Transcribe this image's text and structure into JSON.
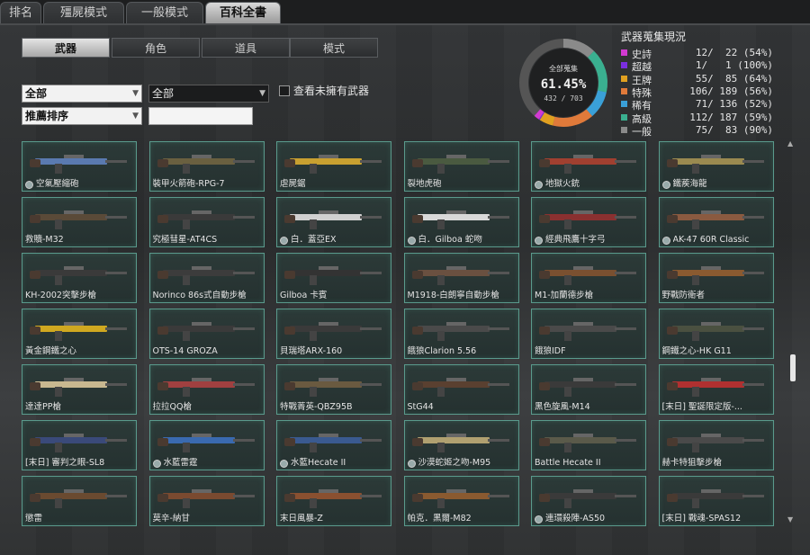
{
  "top_tabs": [
    {
      "label": "排名",
      "active": false
    },
    {
      "label": "殭屍模式",
      "active": false
    },
    {
      "label": "一般模式",
      "active": false
    },
    {
      "label": "百科全書",
      "active": true
    }
  ],
  "sub_tabs": [
    {
      "label": "武器",
      "active": true
    },
    {
      "label": "角色",
      "active": false
    },
    {
      "label": "道具",
      "active": false
    },
    {
      "label": "模式",
      "active": false
    }
  ],
  "filters": {
    "category_1": "全部",
    "category_2": "全部",
    "sort": "推薦排序",
    "search_value": "",
    "unowned_label": "查看未擁有武器",
    "unowned_checked": false
  },
  "collection": {
    "title": "武器蒐集現況",
    "donut_label": "全部蒐集",
    "donut_percent": "61.45%",
    "donut_count": "432 / 703",
    "percent_value": 61.45,
    "rarities": [
      {
        "name": "史詩",
        "value": "12/  22 (54%)",
        "color": "#d23ad2"
      },
      {
        "name": "超越",
        "value": " 1/   1 (100%)",
        "color": "#7a2ee0"
      },
      {
        "name": "王牌",
        "value": "55/  85 (64%)",
        "color": "#e0a020"
      },
      {
        "name": "特殊",
        "value": "106/ 189 (56%)",
        "color": "#e07a3a"
      },
      {
        "name": "稀有",
        "value": " 71/ 136 (52%)",
        "color": "#3aa0d8"
      },
      {
        "name": "高級",
        "value": "112/ 187 (59%)",
        "color": "#3ab090"
      },
      {
        "name": "一般",
        "value": " 75/  83 (90%)",
        "color": "#8a8a8a"
      }
    ]
  },
  "weapons": [
    {
      "label": "空氣壓縮砲",
      "gear": true,
      "c": "#5a7ab0"
    },
    {
      "label": "裝甲火箭砲-RPG-7",
      "gear": false,
      "c": "#6a6040"
    },
    {
      "label": "虐屍鋸",
      "gear": false,
      "c": "#c8a030"
    },
    {
      "label": "裂地虎砲",
      "gear": false,
      "c": "#4a5a40"
    },
    {
      "label": "地獄火銃",
      "gear": true,
      "c": "#a04030"
    },
    {
      "label": "鐵蒺海龍",
      "gear": true,
      "c": "#9a8a50"
    },
    {
      "label": "救贖-M32",
      "gear": false,
      "c": "#5a4a38"
    },
    {
      "label": "究極彗星-AT4CS",
      "gear": false,
      "c": "#3a3a3a"
    },
    {
      "label": "白．蓋亞EX",
      "gear": true,
      "c": "#d0d0d0"
    },
    {
      "label": "白．Gilboa 蛇吻",
      "gear": true,
      "c": "#d8d8d8"
    },
    {
      "label": "經典飛鷹十字弓",
      "gear": true,
      "c": "#8a3030"
    },
    {
      "label": "AK-47 60R Classic",
      "gear": true,
      "c": "#8a5a40"
    },
    {
      "label": "KH-2002突擊步槍",
      "gear": false,
      "c": "#3a3a3a"
    },
    {
      "label": "Norinco 86s式自動步槍",
      "gear": false,
      "c": "#3c3c3c"
    },
    {
      "label": "Gilboa 卡賓",
      "gear": false,
      "c": "#333333"
    },
    {
      "label": "M1918-白朗寧自動步槍",
      "gear": false,
      "c": "#6a5040"
    },
    {
      "label": "M1-加蘭德步槍",
      "gear": false,
      "c": "#7a5030"
    },
    {
      "label": "野戰防衛者",
      "gear": false,
      "c": "#8a5a30"
    },
    {
      "label": "黃金鋼鐵之心",
      "gear": false,
      "c": "#d0a820"
    },
    {
      "label": "OTS-14 GROZA",
      "gear": false,
      "c": "#3a3a3a"
    },
    {
      "label": "貝瑞塔ARX-160",
      "gear": false,
      "c": "#3a3a3a"
    },
    {
      "label": "餓狼Clarion 5.56",
      "gear": false,
      "c": "#4a4a4a"
    },
    {
      "label": "餓狼IDF",
      "gear": false,
      "c": "#4a4a4a"
    },
    {
      "label": "鋼鐵之心-HK G11",
      "gear": false,
      "c": "#4a5040"
    },
    {
      "label": "達達PP槍",
      "gear": false,
      "c": "#c8b890"
    },
    {
      "label": "拉拉QQ槍",
      "gear": false,
      "c": "#a04040"
    },
    {
      "label": "特戰菁英-QBZ95B",
      "gear": false,
      "c": "#6a5a40"
    },
    {
      "label": "StG44",
      "gear": false,
      "c": "#5a4030"
    },
    {
      "label": "黑色旋風-M14",
      "gear": false,
      "c": "#3a3a3a"
    },
    {
      "label": "[末日] 聖誕限定版-...",
      "gear": false,
      "c": "#b03030"
    },
    {
      "label": "[末日] 審判之眼-SL8",
      "gear": false,
      "c": "#3a4a7a"
    },
    {
      "label": "水藍雷霆",
      "gear": true,
      "c": "#3a6ab0"
    },
    {
      "label": "水藍Hecate II",
      "gear": true,
      "c": "#3a5a90"
    },
    {
      "label": "沙漠蛇姬之吻-M95",
      "gear": true,
      "c": "#b0a070"
    },
    {
      "label": "Battle Hecate II",
      "gear": false,
      "c": "#5a5a4a"
    },
    {
      "label": "赫卡特狙擊步槍",
      "gear": false,
      "c": "#4a4a4a"
    },
    {
      "label": "懲雷",
      "gear": false,
      "c": "#6a4a30"
    },
    {
      "label": "莫辛-納甘",
      "gear": false,
      "c": "#7a4a30"
    },
    {
      "label": "末日風暴-Z",
      "gear": false,
      "c": "#8a5030"
    },
    {
      "label": "帕克．黑爾-M82",
      "gear": false,
      "c": "#8a5a30"
    },
    {
      "label": "連環殺陣-AS50",
      "gear": true,
      "c": "#3a3a3a"
    },
    {
      "label": "[末日] 戰魂-SPAS12",
      "gear": false,
      "c": "#3a3a3a"
    }
  ]
}
